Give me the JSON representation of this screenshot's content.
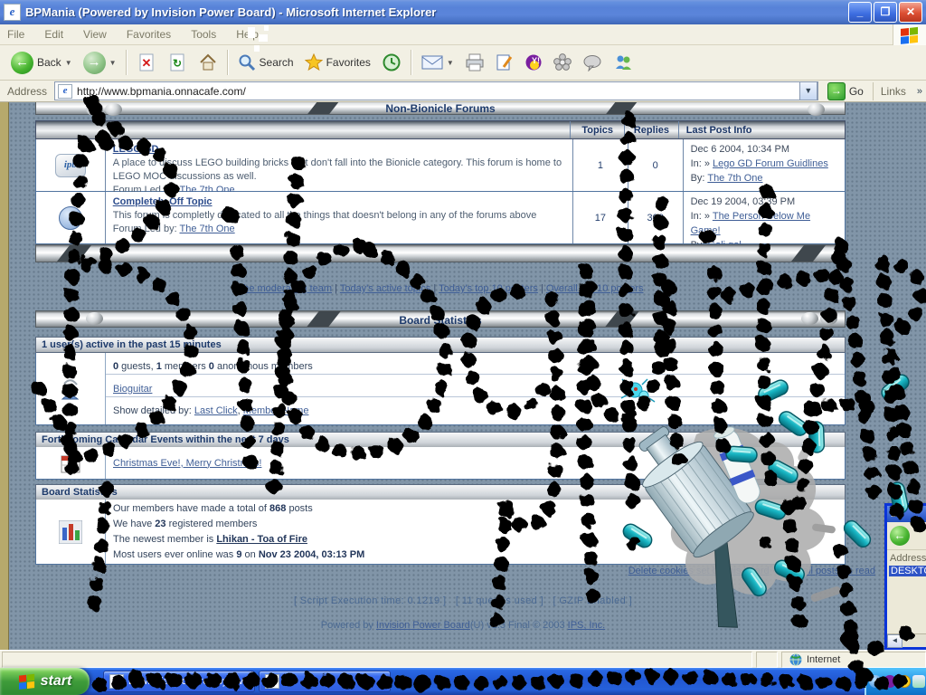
{
  "palette": {
    "page_bg": "#8195a8",
    "table_border": "#51749f",
    "link": "#3f5e96",
    "header_text": "#1d3a6b",
    "titlebar": "#5782d8",
    "taskbar": "#2258d2",
    "graffiti": "#000000",
    "capsule_teal": "#0b9aa6"
  },
  "window": {
    "title": "BPMania (Powered by Invision Power Board) - Microsoft Internet Explorer",
    "menu": {
      "file": "File",
      "edit": "Edit",
      "view": "View",
      "favorites": "Favorites",
      "tools": "Tools",
      "help": "Help"
    },
    "toolbar": {
      "back": "Back",
      "search": "Search",
      "favorites": "Favorites"
    },
    "address": {
      "label": "Address",
      "url": "http://www.bpmania.onnacafe.com/",
      "go": "Go",
      "links": "Links",
      "chevron": "»"
    },
    "status_zone": "Internet"
  },
  "forum": {
    "category_title": "Non-Bionicle Forums",
    "columns": {
      "topics": "Topics",
      "replies": "Replies",
      "last_post": "Last Post Info"
    },
    "rows": [
      {
        "name": "LEGO GD",
        "desc": "A place to discuss LEGO building bricks that don't fall into the Bionicle category. This forum is home to LEGO MOC discussions as well.",
        "led_prefix": "Forum Led by: ",
        "leader": "The 7th One",
        "topics": "1",
        "replies": "0",
        "date": "Dec 6 2004, 10:34 PM",
        "in_label": "In: »",
        "in_topic": "Lego GD Forum Guidlines",
        "by_label": "By:",
        "by_user": "The 7th One",
        "icon_text": "ipb"
      },
      {
        "name": "Completely Off Topic",
        "desc": "This forum is completly dedicated to all the things that doesn't belong in any of the forums above",
        "led_prefix": "Forum Led by: ",
        "leader": "The 7th One",
        "topics": "17",
        "replies": "308",
        "date": "Dec 19 2004, 03:39 PM",
        "in_label": "In: »",
        "in_topic": "The Person Below Me Game!",
        "by_label": "By:",
        "by_user": "Gali gal",
        "icon_text": "i"
      }
    ]
  },
  "links_row": {
    "l1": "The moderating team",
    "l2": "Today's active topics",
    "l3": "Today's top 10 posters",
    "l4": "Overall top 10 posters",
    "sep": " | "
  },
  "sections": {
    "board_statistics_banner": "Board Statistics",
    "active_header": "1 user(s) active in the past 15 minutes",
    "active_line": {
      "g_num": "0",
      "g_txt": " guests, ",
      "m_num": "1",
      "m_txt": " members ",
      "a_num": "0",
      "a_txt": " anonymous members"
    },
    "active_user": "Bioguitar",
    "show_detailed": "Show detailed by: ",
    "last_click": "Last Click",
    "comma": ", ",
    "member_name": "Member Name",
    "calendar_header": "Forthcoming Calendar Events within the next 7 days",
    "calendar_events": "Christmas Eve!, Merry Christmas!",
    "stats_header": "Board Statistics",
    "stats": {
      "l1a": "Our members have made a total of ",
      "l1b": "868",
      "l1c": " posts",
      "l2a": "We have ",
      "l2b": "23",
      "l2c": " registered members",
      "l3a": "The newest member is ",
      "l3b": "Lhikan - Toa of Fire",
      "l4a": "Most users ever online was ",
      "l4b": "9",
      "l4c": " on ",
      "l4d": "Nov 23 2004, 03:13 PM"
    },
    "delete_cookies": "Delete cookies set by this board",
    "dot_sep": " · ",
    "mark_read": "Mark all posts as read"
  },
  "footer": {
    "script_time": "[ Script Execution time: 0.1219 ]",
    "queries": "[ 11 queries used ]",
    "gzip": "[ GZIP Enabled ]",
    "powered_prefix": "Powered by ",
    "powered_link": "Invision Power Board",
    "powered_mid": "(U) v1.3 Final © 2003 ",
    "powered_org": "IPS, Inc."
  },
  "taskbar": {
    "start": "start",
    "task1": "BPMania (Powered by Inv...",
    "task2": ""
  },
  "overlay_window": {
    "title_fragment": "D",
    "address_label": "Address",
    "selection": "DESKTO",
    "scroll_left": "◄"
  },
  "graffiti_word": "BiOguitAR"
}
